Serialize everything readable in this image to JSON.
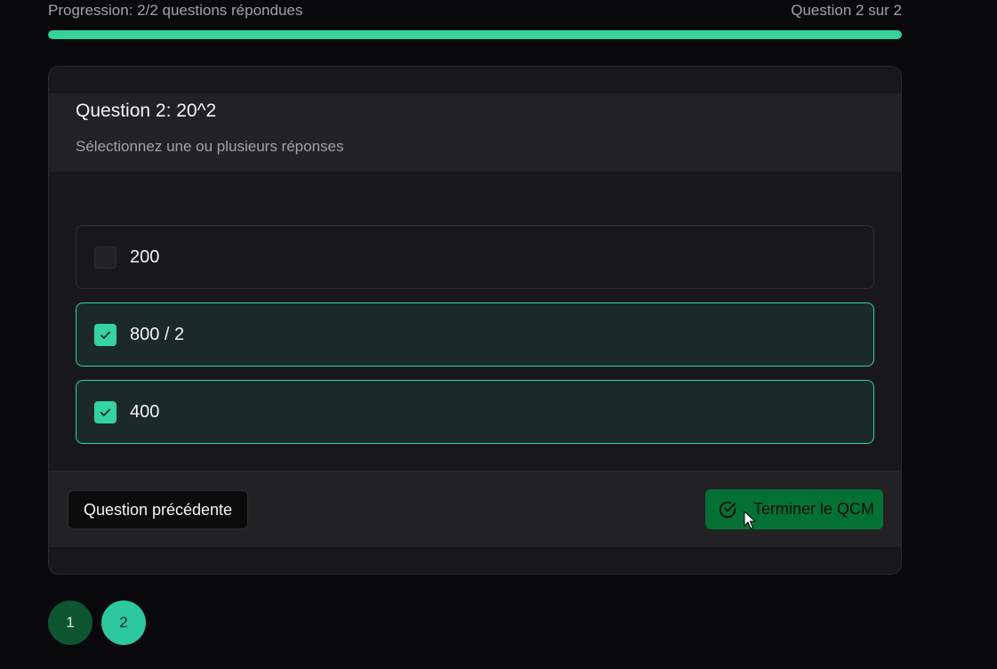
{
  "progress": {
    "label": "Progression: 2/2 questions répondues",
    "position": "Question 2 sur 2",
    "fraction": 1.0
  },
  "question": {
    "title": "Question 2: 20^2",
    "instruction": "Sélectionnez une ou plusieurs réponses",
    "options": [
      {
        "label": "200",
        "checked": false
      },
      {
        "label": "800 / 2",
        "checked": true
      },
      {
        "label": "400",
        "checked": true
      }
    ]
  },
  "footer": {
    "prev_label": "Question précédente",
    "finish_label": "Terminer le QCM"
  },
  "pager": {
    "pages": [
      "1",
      "2"
    ],
    "current": "2"
  },
  "colors": {
    "accent": "#34d399",
    "finish_button": "#047134",
    "page_answered": "#0d5530",
    "page_current": "#2dc8a0"
  },
  "icons": {
    "checkbox_check": "check-icon",
    "finish": "check-circle-icon",
    "mouse": "mouse-pointer-icon"
  }
}
